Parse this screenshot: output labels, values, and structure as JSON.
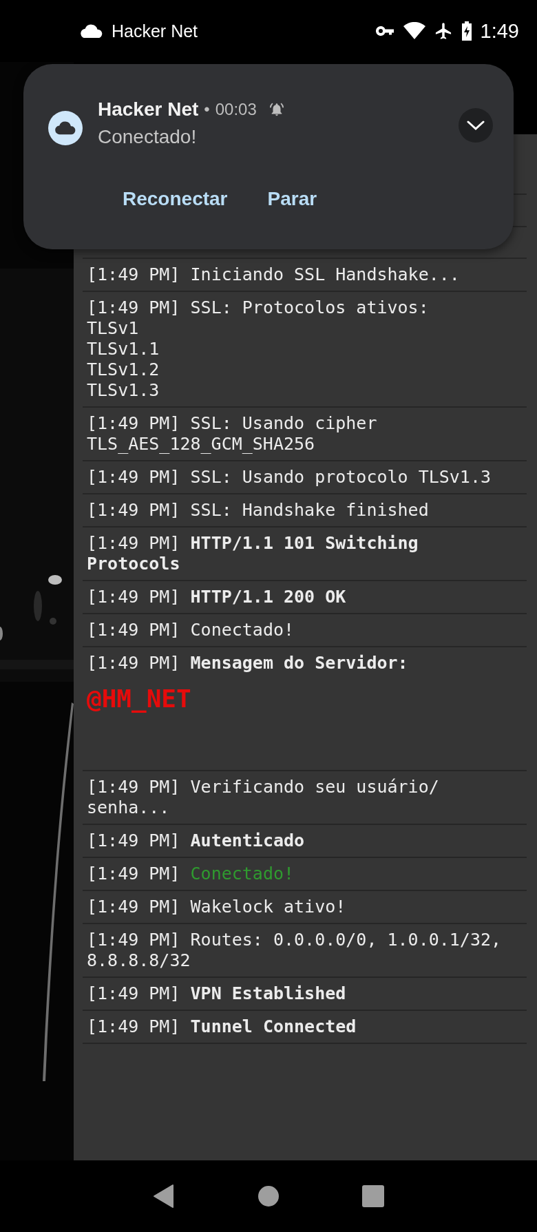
{
  "status_bar": {
    "app_name": "Hacker Net",
    "time": "1:49"
  },
  "notification": {
    "app_name": "Hacker Net",
    "separator": "•",
    "elapsed": "00:03",
    "message": "Conectado!",
    "actions": [
      "Reconectar",
      "Parar"
    ]
  },
  "log": [
    {
      "time": "[1:49 PM]",
      "text": "Iniciando SSL Handshake...",
      "kind": "plain"
    },
    {
      "time": "[1:49 PM]",
      "text": "SSL: Protocolos ativos:\nTLSv1\nTLSv1.1\nTLSv1.2\nTLSv1.3",
      "kind": "plain"
    },
    {
      "time": "[1:49 PM]",
      "text": "SSL: Usando cipher\nTLS_AES_128_GCM_SHA256",
      "kind": "plain"
    },
    {
      "time": "[1:49 PM]",
      "text": "SSL: Usando protocolo TLSv1.3",
      "kind": "plain"
    },
    {
      "time": "[1:49 PM]",
      "text": "SSL: Handshake finished",
      "kind": "plain"
    },
    {
      "time": "[1:49 PM]",
      "text": "HTTP/1.1 101 Switching\nProtocols",
      "kind": "bold"
    },
    {
      "time": "[1:49 PM]",
      "text": "HTTP/1.1 200 OK",
      "kind": "bold"
    },
    {
      "time": "[1:49 PM]",
      "text": "Conectado!",
      "kind": "plain"
    },
    {
      "time": "[1:49 PM]",
      "text": "Mensagem do Servidor:",
      "kind": "bold",
      "extra": "@HM_NET"
    },
    {
      "time": "[1:49 PM]",
      "text": "Verificando seu usuário/\nsenha...",
      "kind": "plain"
    },
    {
      "time": "[1:49 PM]",
      "text": "Autenticado",
      "kind": "bold"
    },
    {
      "time": "[1:49 PM]",
      "text": "Conectado!",
      "kind": "success"
    },
    {
      "time": "[1:49 PM]",
      "text": "Wakelock ativo!",
      "kind": "plain"
    },
    {
      "time": "[1:49 PM]",
      "text": "Routes: 0.0.0.0/0, 1.0.0.1/32,\n8.8.8.8/32",
      "kind": "plain"
    },
    {
      "time": "[1:49 PM]",
      "text": "VPN Established",
      "kind": "bold"
    },
    {
      "time": "[1:49 PM]",
      "text": "Tunnel Connected",
      "kind": "bold"
    }
  ]
}
